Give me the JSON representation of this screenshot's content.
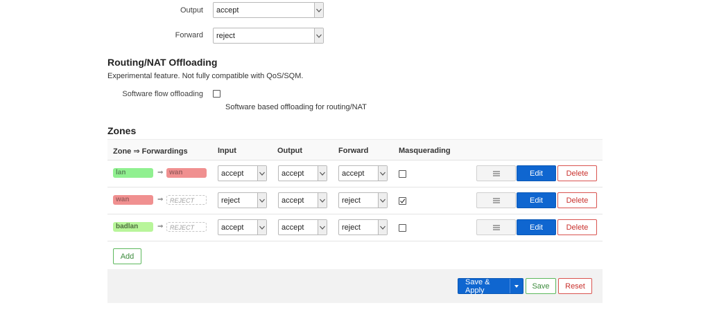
{
  "general": {
    "output_label": "Output",
    "output_value": "accept",
    "forward_label": "Forward",
    "forward_value": "reject"
  },
  "offloading": {
    "title": "Routing/NAT Offloading",
    "description": "Experimental feature. Not fully compatible with QoS/SQM.",
    "software_label": "Software flow offloading",
    "software_checked": false,
    "software_hint": "Software based offloading for routing/NAT"
  },
  "zones": {
    "title": "Zones",
    "columns": [
      "Zone ⇒ Forwardings",
      "Input",
      "Output",
      "Forward",
      "Masquerading"
    ],
    "arrow": "⇒",
    "rows": [
      {
        "zone": "lan",
        "forward_to": "wan",
        "input": "accept",
        "output": "accept",
        "forward": "accept",
        "masquerading": false
      },
      {
        "zone": "wan",
        "forward_to": "REJECT",
        "input": "reject",
        "output": "accept",
        "forward": "reject",
        "masquerading": true
      },
      {
        "zone": "badlan",
        "forward_to": "REJECT",
        "input": "accept",
        "output": "accept",
        "forward": "reject",
        "masquerading": false
      }
    ],
    "edit_label": "Edit",
    "delete_label": "Delete",
    "menu_icon": "hamburger-icon",
    "add_label": "Add"
  },
  "actions": {
    "save_apply_label": "Save & Apply",
    "save_label": "Save",
    "reset_label": "Reset"
  },
  "colors": {
    "lan": "#90f090",
    "wan": "#f09090",
    "badlan": "#b8f59a",
    "primary": "#0f66d0",
    "danger": "#d9534f",
    "success": "#5cb85c"
  }
}
